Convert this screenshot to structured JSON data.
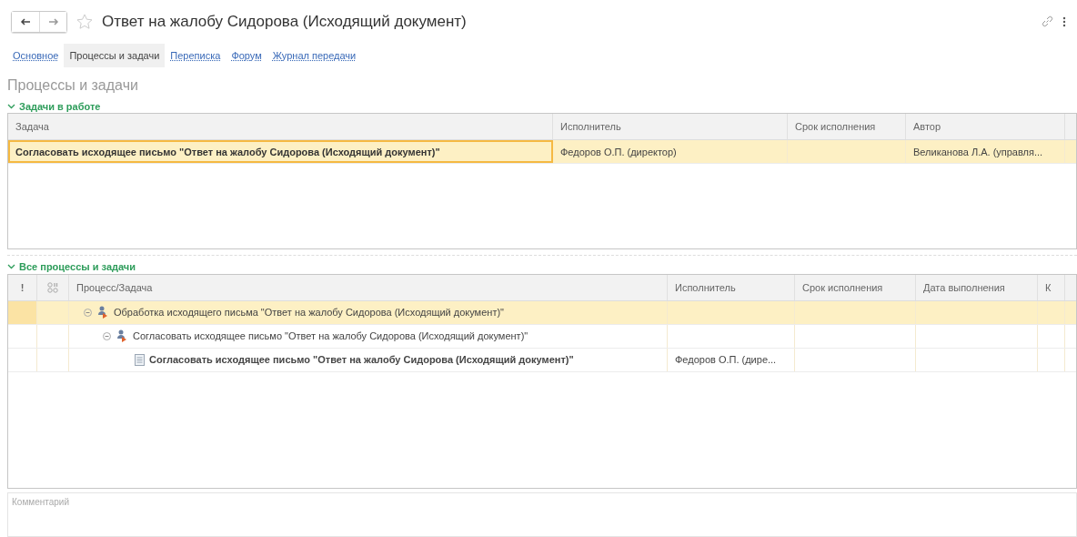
{
  "window": {
    "title": "Ответ на жалобу Сидорова (Исходящий документ)"
  },
  "tabs": [
    {
      "label": "Основное",
      "selected": false
    },
    {
      "label": "Процессы и задачи",
      "selected": true
    },
    {
      "label": "Переписка",
      "selected": false
    },
    {
      "label": "Форум",
      "selected": false
    },
    {
      "label": "Журнал передачи",
      "selected": false
    }
  ],
  "section_title": "Процессы и задачи",
  "tasks_group": {
    "title": "Задачи в работе",
    "expanded": true,
    "columns": [
      "Задача",
      "Исполнитель",
      "Срок исполнения",
      "Автор"
    ],
    "rows": [
      {
        "task": "Согласовать исходящее письмо \"Ответ на жалобу Сидорова (Исходящий документ)\"",
        "executor": "Федоров О.П. (директор)",
        "author": "Великанова Л.А. (управля...",
        "selected": true
      }
    ]
  },
  "all_group": {
    "title": "Все процессы и задачи",
    "expanded": true,
    "columns": [
      "!",
      "",
      "Процесс/Задача",
      "Исполнитель",
      "Срок исполнения",
      "Дата выполнения",
      "К"
    ],
    "rows": [
      {
        "kind": "process",
        "name": "Обработка исходящего письма \"Ответ на жалобу Сидорова (Исходящий документ)\"",
        "selected": true,
        "expanded": true,
        "children": [
          {
            "kind": "process",
            "name": "Согласовать исходящее письмо \"Ответ на жалобу Сидорова (Исходящий документ)\"",
            "selected": false,
            "expanded": true,
            "children": [
              {
                "kind": "task",
                "name": "Согласовать исходящее письмо \"Ответ на жалобу Сидорова (Исходящий документ)\"",
                "executor": "Федоров О.П. (дире...",
                "selected": false
              }
            ]
          }
        ]
      }
    ]
  },
  "comment": {
    "placeholder": "Комментарий"
  }
}
